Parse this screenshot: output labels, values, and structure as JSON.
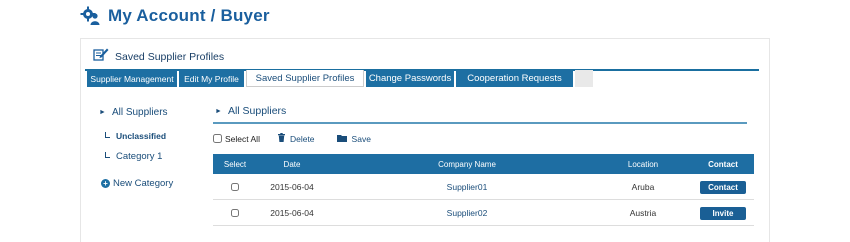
{
  "page": {
    "title": "My Account / Buyer",
    "icon": "gear-user-icon"
  },
  "panel": {
    "title": "Saved Supplier Profiles",
    "icon": "edit-document-icon"
  },
  "tabs": [
    {
      "label": "Supplier Management",
      "active": false
    },
    {
      "label": "Edit My Profile",
      "active": false
    },
    {
      "label": "Saved Supplier Profiles",
      "active": true
    },
    {
      "label": "Change Passwords",
      "active": false
    },
    {
      "label": "Cooperation Requests",
      "active": false
    }
  ],
  "sidebar": {
    "all": "All Suppliers",
    "unclassified": "Unclassified",
    "category": "Category 1",
    "new_category": "New Category"
  },
  "content": {
    "title": "All Suppliers"
  },
  "toolbar": {
    "select_all": "Select All",
    "delete": "Delete",
    "save": "Save"
  },
  "table": {
    "headers": {
      "select": "Select",
      "date": "Date",
      "company": "Company Name",
      "location": "Location",
      "contact": "Contact"
    },
    "rows": [
      {
        "date": "2015-06-04",
        "company": "Supplier01",
        "location": "Aruba",
        "action": "Contact"
      },
      {
        "date": "2015-06-04",
        "company": "Supplier02",
        "location": "Austria",
        "action": "Invite"
      }
    ]
  },
  "colors": {
    "brand": "#1a5f9e",
    "tab": "#1d6fa3",
    "header": "#1e6ea3"
  }
}
